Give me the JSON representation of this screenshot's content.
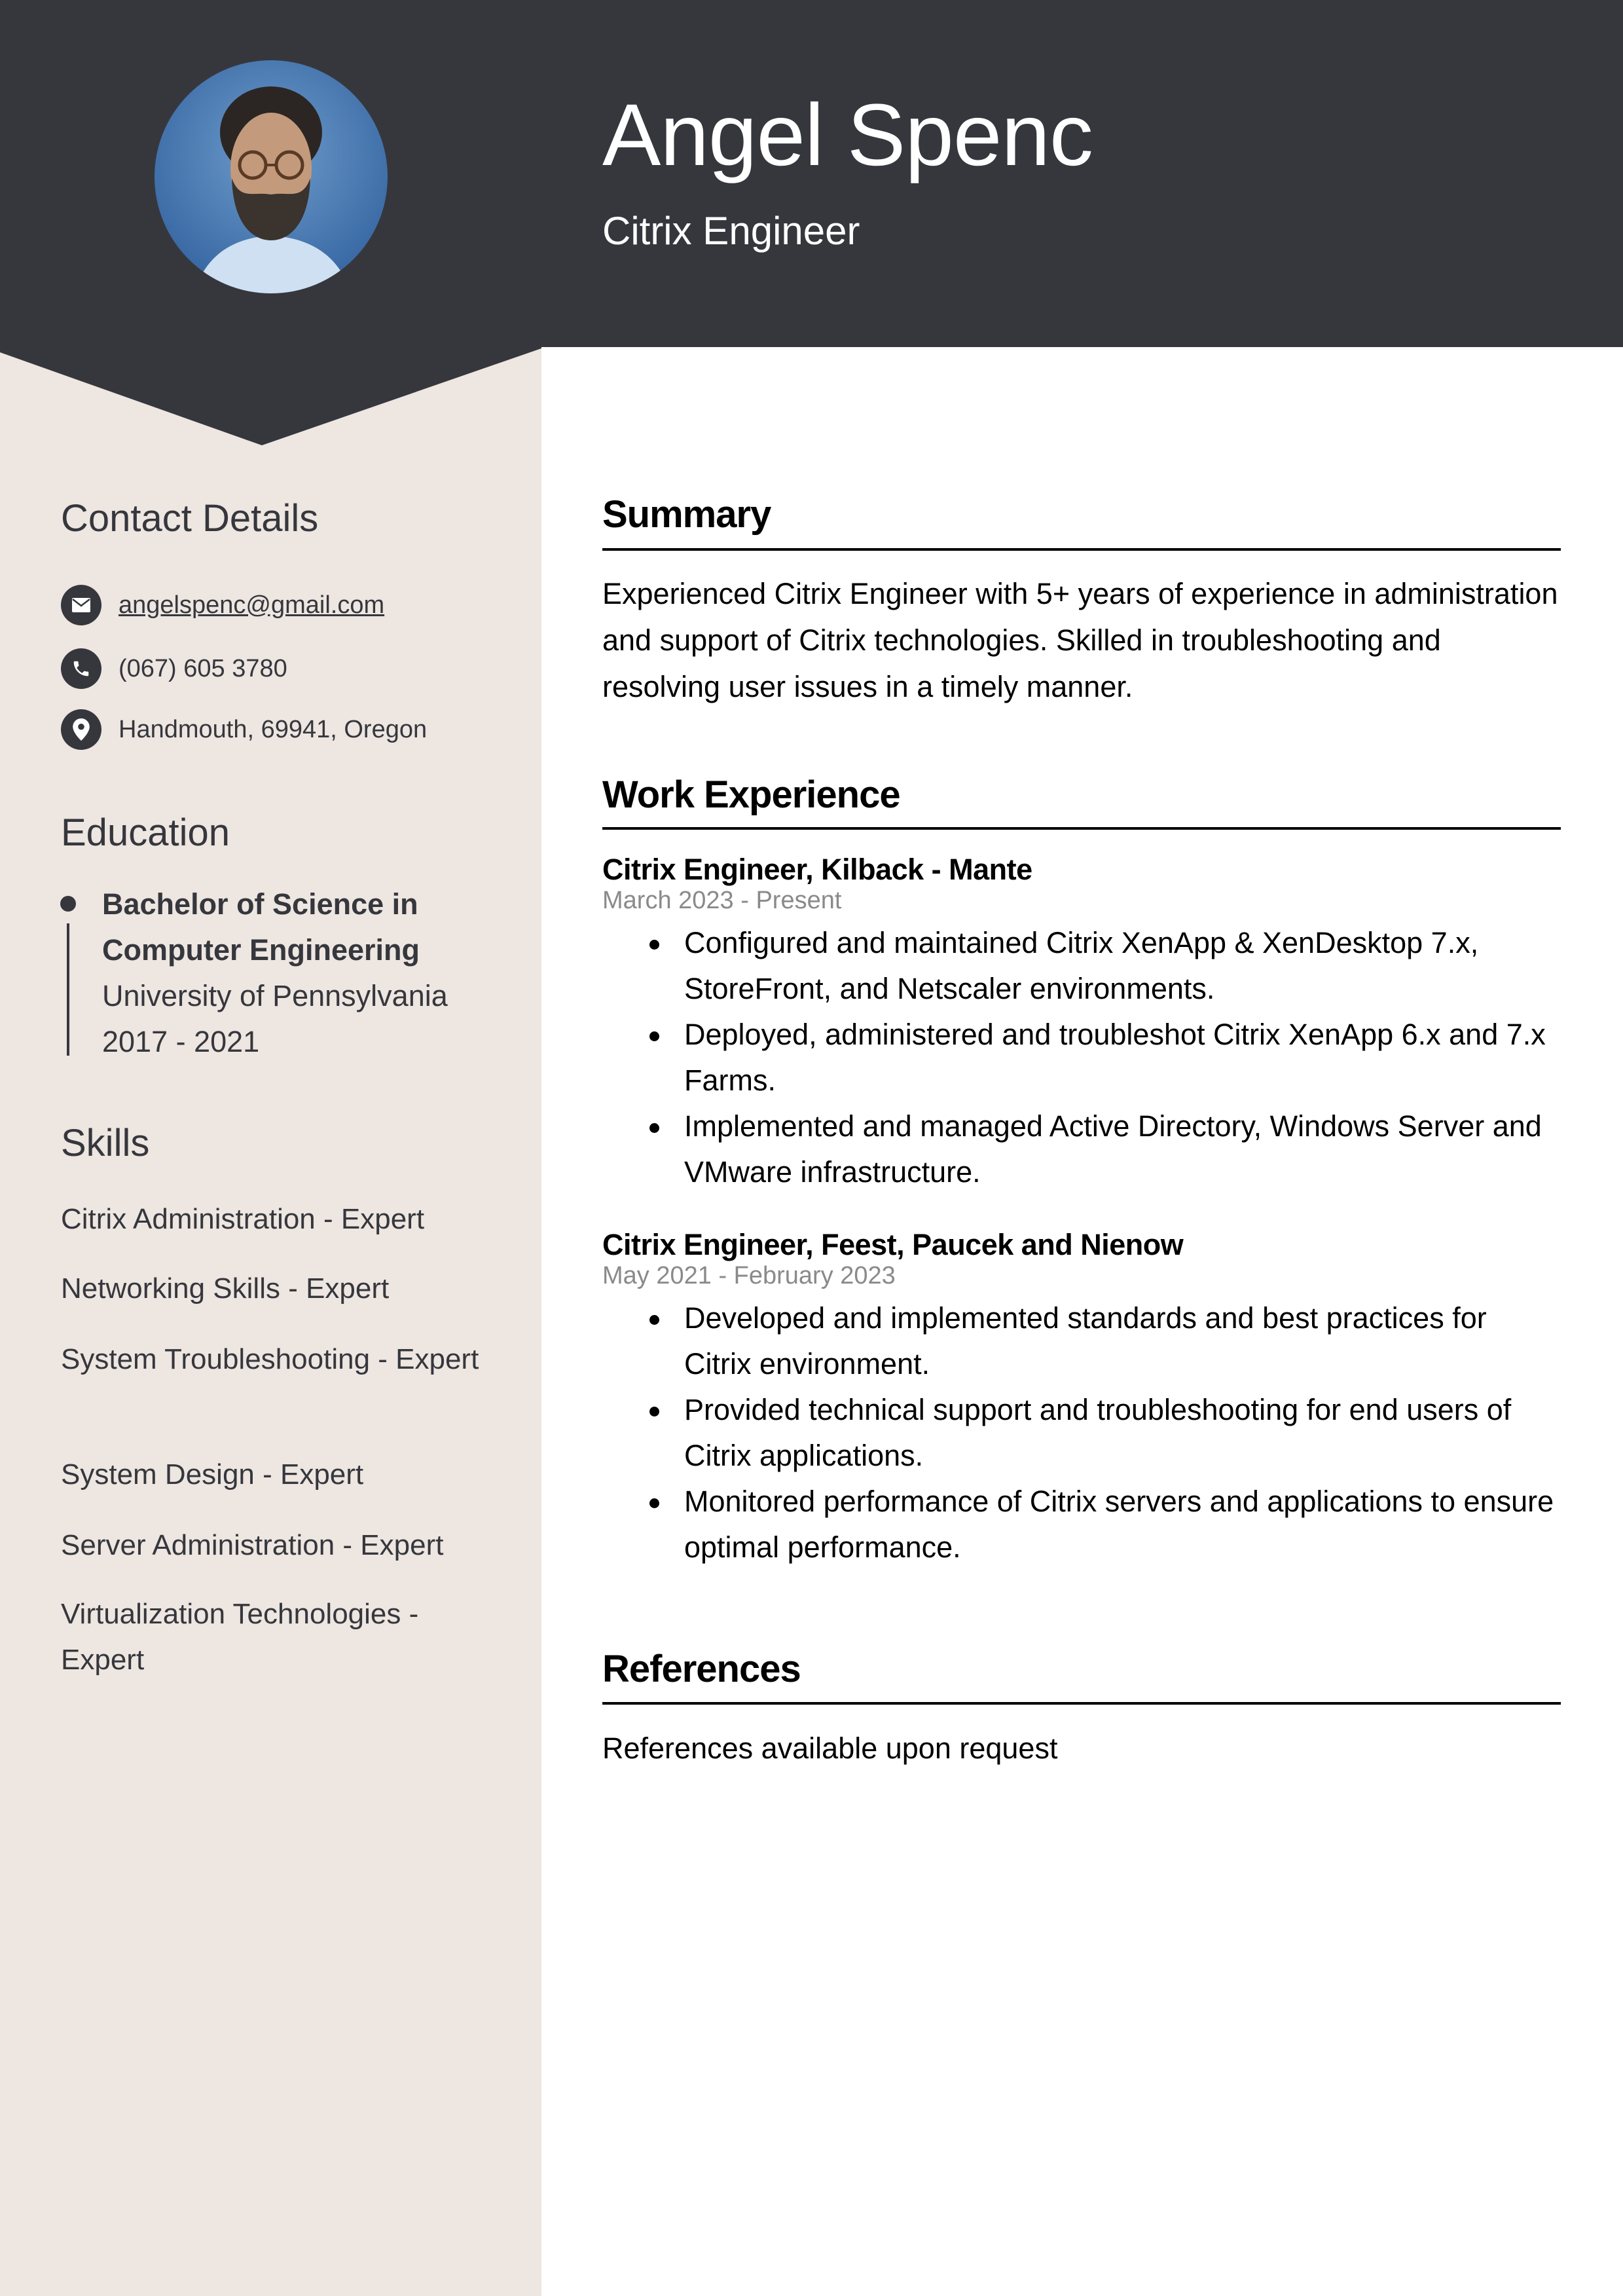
{
  "header": {
    "name": "Angel Spenc",
    "job_title": "Citrix Engineer",
    "photo_alt": "Profile photo of a man with curly hair, glasses and beard against blue background"
  },
  "colors": {
    "header_bg": "#36373d",
    "sidebar_bg": "#ede6e1",
    "text_dark": "#36373d",
    "date_gray": "#8a8a8a"
  },
  "sidebar": {
    "contact": {
      "heading": "Contact Details",
      "items": [
        {
          "icon": "envelope-icon",
          "text": "angelspenc@gmail.com"
        },
        {
          "icon": "phone-icon",
          "text": "(067) 605 3780"
        },
        {
          "icon": "location-pin-icon",
          "text": "Handmouth, 69941, Oregon"
        }
      ]
    },
    "education": {
      "heading": "Education",
      "degree_line1": "Bachelor of Science in",
      "degree_line2": "Computer Engineering",
      "school": "University of Pennsylvania",
      "years": "2017 - 2021"
    },
    "skills": {
      "heading": "Skills",
      "items": [
        "Citrix Administration - Expert",
        "Networking Skills - Expert",
        "System Troubleshooting - Expert",
        "System Design - Expert",
        "Server Administration - Expert",
        "Virtualization Technologies - Expert"
      ]
    }
  },
  "main": {
    "summary": {
      "heading": "Summary",
      "text": "Experienced Citrix Engineer with 5+ years of experience in administration and support of Citrix technologies. Skilled in troubleshooting and resolving user issues in a timely manner."
    },
    "experience": {
      "heading": "Work Experience",
      "jobs": [
        {
          "title": "Citrix Engineer, Kilback - Mante",
          "dates": "March 2023 - Present",
          "bullets": [
            "Configured and maintained Citrix XenApp & XenDesktop 7.x, StoreFront, and Netscaler environments.",
            "Deployed, administered and troubleshot Citrix XenApp 6.x and 7.x Farms.",
            "Implemented and managed Active Directory, Windows Server and VMware infrastructure."
          ]
        },
        {
          "title": "Citrix Engineer, Feest, Paucek and Nienow",
          "dates": "May 2021 - February 2023",
          "bullets": [
            "Developed and implemented standards and best practices for Citrix environment.",
            "Provided technical support and troubleshooting for end users of Citrix applications.",
            "Monitored performance of Citrix servers and applications to ensure optimal performance."
          ]
        }
      ]
    },
    "references": {
      "heading": "References",
      "text": "References available upon request"
    }
  }
}
